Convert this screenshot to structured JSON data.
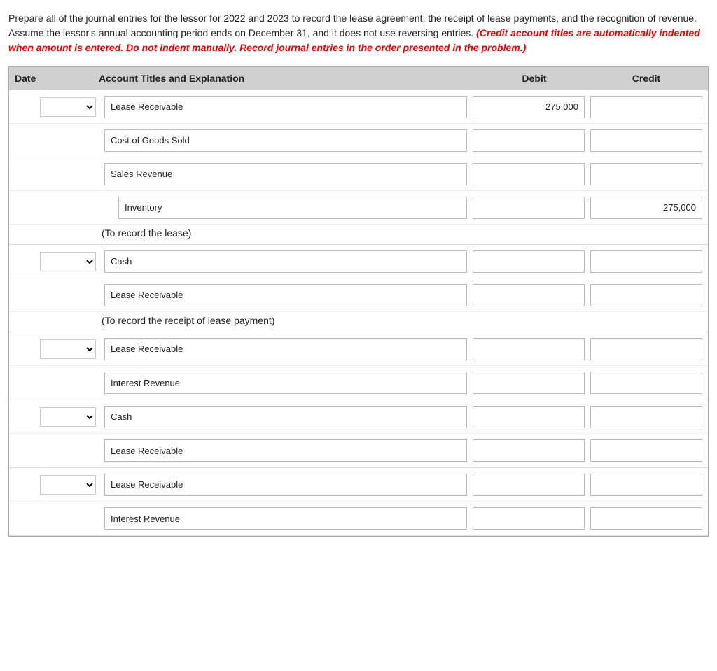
{
  "instructions": {
    "main_text": "Prepare all of the journal entries for the lessor for 2022 and 2023 to record the lease agreement, the receipt of lease payments, and the recognition of revenue. Assume the lessor's annual accounting period ends on December 31, and it does not use reversing entries.",
    "red_text": "(Credit account titles are automatically indented when amount is entered. Do not indent manually. Record journal entries in the order presented in the problem.)"
  },
  "table": {
    "headers": {
      "date": "Date",
      "account": "Account Titles and Explanation",
      "debit": "Debit",
      "credit": "Credit"
    },
    "entry_groups": [
      {
        "id": "group1",
        "rows": [
          {
            "id": "row1",
            "has_date_select": true,
            "account_label": "Lease Receivable",
            "account_indented": false,
            "debit_value": "275,000",
            "credit_value": ""
          },
          {
            "id": "row2",
            "has_date_select": false,
            "account_label": "Cost of Goods Sold",
            "account_indented": false,
            "debit_value": "",
            "credit_value": ""
          },
          {
            "id": "row3",
            "has_date_select": false,
            "account_label": "Sales Revenue",
            "account_indented": false,
            "debit_value": "",
            "credit_value": ""
          },
          {
            "id": "row4",
            "has_date_select": false,
            "account_label": "Inventory",
            "account_indented": true,
            "debit_value": "",
            "credit_value": "275,000"
          }
        ],
        "note": "(To record the lease)"
      },
      {
        "id": "group2",
        "rows": [
          {
            "id": "row5",
            "has_date_select": true,
            "account_label": "Cash",
            "account_indented": false,
            "debit_value": "",
            "credit_value": ""
          },
          {
            "id": "row6",
            "has_date_select": false,
            "account_label": "Lease Receivable",
            "account_indented": false,
            "debit_value": "",
            "credit_value": ""
          }
        ],
        "note": "(To record the receipt of lease payment)"
      },
      {
        "id": "group3",
        "rows": [
          {
            "id": "row7",
            "has_date_select": true,
            "account_label": "Lease Receivable",
            "account_indented": false,
            "debit_value": "",
            "credit_value": ""
          },
          {
            "id": "row8",
            "has_date_select": false,
            "account_label": "Interest Revenue",
            "account_indented": false,
            "debit_value": "",
            "credit_value": ""
          }
        ],
        "note": ""
      },
      {
        "id": "group4",
        "rows": [
          {
            "id": "row9",
            "has_date_select": true,
            "account_label": "Cash",
            "account_indented": false,
            "debit_value": "",
            "credit_value": ""
          },
          {
            "id": "row10",
            "has_date_select": false,
            "account_label": "Lease Receivable",
            "account_indented": false,
            "debit_value": "",
            "credit_value": ""
          }
        ],
        "note": ""
      },
      {
        "id": "group5",
        "rows": [
          {
            "id": "row11",
            "has_date_select": true,
            "account_label": "Lease Receivable",
            "account_indented": false,
            "debit_value": "",
            "credit_value": ""
          },
          {
            "id": "row12",
            "has_date_select": false,
            "account_label": "Interest Revenue",
            "account_indented": false,
            "debit_value": "",
            "credit_value": ""
          }
        ],
        "note": ""
      }
    ]
  }
}
